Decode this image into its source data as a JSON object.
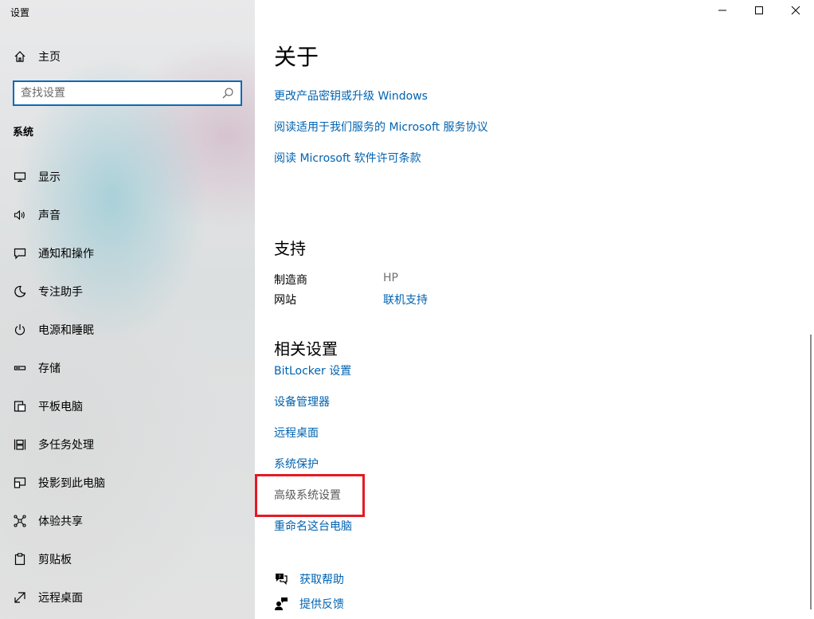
{
  "window": {
    "title": "设置",
    "controls": {
      "minimize": "minimize",
      "maximize": "maximize",
      "close": "close"
    }
  },
  "sidebar": {
    "home_label": "主页",
    "search": {
      "placeholder": "查找设置",
      "value": ""
    },
    "section_title": "系统",
    "items": [
      {
        "label": "显示",
        "icon": "monitor-icon"
      },
      {
        "label": "声音",
        "icon": "speaker-icon"
      },
      {
        "label": "通知和操作",
        "icon": "message-icon"
      },
      {
        "label": "专注助手",
        "icon": "moon-icon"
      },
      {
        "label": "电源和睡眠",
        "icon": "power-icon"
      },
      {
        "label": "存储",
        "icon": "storage-icon"
      },
      {
        "label": "平板电脑",
        "icon": "tablet-icon"
      },
      {
        "label": "多任务处理",
        "icon": "multitask-icon"
      },
      {
        "label": "投影到此电脑",
        "icon": "project-icon"
      },
      {
        "label": "体验共享",
        "icon": "share-icon"
      },
      {
        "label": "剪贴板",
        "icon": "clipboard-icon"
      },
      {
        "label": "远程桌面",
        "icon": "remote-icon"
      }
    ]
  },
  "main": {
    "title": "关于",
    "top_links": [
      "更改产品密钥或升级 Windows",
      "阅读适用于我们服务的 Microsoft 服务协议",
      "阅读 Microsoft 软件许可条款"
    ],
    "support": {
      "heading": "支持",
      "manufacturer_key": "制造商",
      "manufacturer_value": "HP",
      "website_key": "网站",
      "website_value": "联机支持"
    },
    "related": {
      "heading": "相关设置",
      "links": [
        "BitLocker 设置",
        "设备管理器",
        "远程桌面",
        "系统保护"
      ],
      "advanced": "高级系统设置",
      "rename": "重命名这台电脑"
    },
    "help": {
      "get_help": "获取帮助",
      "feedback": "提供反馈"
    }
  },
  "colors": {
    "link": "#0063b1",
    "highlight_border": "#e31b23",
    "search_border": "#0b6ab7"
  }
}
